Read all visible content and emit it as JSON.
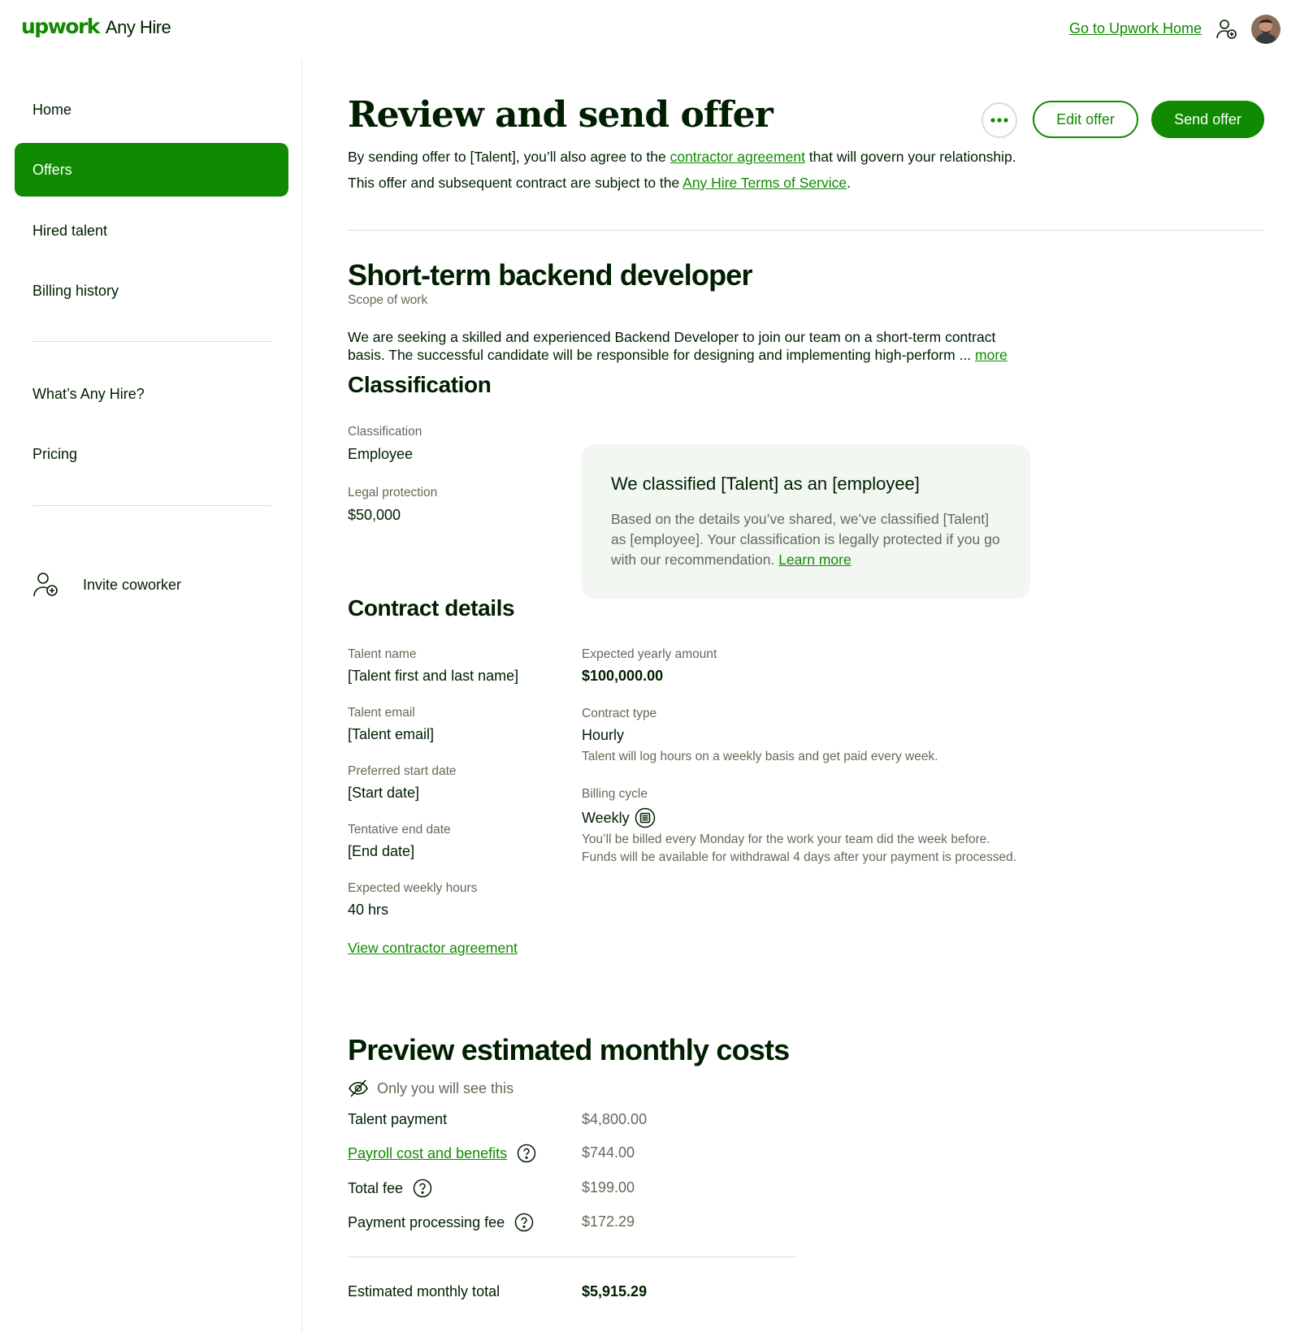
{
  "header": {
    "brand": "upwork",
    "product": "Any Hire",
    "home_link": "Go to Upwork Home"
  },
  "sidebar": {
    "items": [
      {
        "label": "Home"
      },
      {
        "label": "Offers",
        "active": true
      },
      {
        "label": "Hired talent"
      },
      {
        "label": "Billing history"
      }
    ],
    "info_items": [
      {
        "label": "What’s Any Hire?"
      },
      {
        "label": "Pricing"
      }
    ],
    "invite": "Invite coworker"
  },
  "page": {
    "title": "Review and send offer",
    "edit_button": "Edit offer",
    "send_button": "Send offer",
    "intro1_pre": "By sending offer to [Talent], you’ll also agree to the ",
    "intro1_link": "contractor agreement",
    "intro1_post": " that will govern your relationship.",
    "intro2_pre": "This offer and subsequent contract are subject to the ",
    "intro2_link": "Any Hire Terms of Service",
    "intro2_post": "."
  },
  "job": {
    "title": "Short-term backend developer",
    "scope_label": "Scope of work",
    "scope_text": "We are seeking a skilled and experienced Backend Developer to join our team on a short-term contract basis. The successful candidate will be responsible for designing and implementing high-perform ... ",
    "scope_more": "more"
  },
  "classification": {
    "heading": "Classification",
    "class_label": "Classification",
    "class_value": "Employee",
    "legal_label": "Legal protection",
    "legal_value": "$50,000",
    "card_title": "We classified [Talent] as an [employee]",
    "card_body": "Based on the details you’ve shared, we’ve classified [Talent] as [employee]. Your classification is legally protected if you go with our recommendation. ",
    "card_link": "Learn more"
  },
  "contract": {
    "heading": "Contract details",
    "talent_name_label": "Talent name",
    "talent_name": "[Talent first and last name]",
    "talent_email_label": "Talent email",
    "talent_email": "[Talent email]",
    "start_label": "Preferred start date",
    "start": "[Start date]",
    "end_label": "Tentative end date",
    "end": "[End date]",
    "hours_label": "Expected weekly hours",
    "hours": "40 hrs",
    "yearly_label": "Expected yearly amount",
    "yearly": "$100,000.00",
    "type_label": "Contract type",
    "type": "Hourly",
    "type_note": "Talent will log hours on a weekly basis and get paid every week.",
    "billing_label": "Billing cycle",
    "billing": "Weekly",
    "billing_note1": "You’ll be billed every Monday for the work your team did the week before.",
    "billing_note2": "Funds will be available for withdrawal 4 days after your payment is processed.",
    "agreement_link": "View contractor agreement"
  },
  "costs": {
    "heading": "Preview estimated monthly costs",
    "private_note": "Only you will see this",
    "rows": [
      {
        "label": "Talent payment",
        "value": "$4,800.00"
      },
      {
        "label": "Payroll cost and benefits",
        "value": "$744.00"
      },
      {
        "label": "Total fee",
        "value": "$199.00"
      },
      {
        "label": "Payment processing fee",
        "value": "$172.29"
      }
    ],
    "total_label": "Estimated monthly total",
    "total_value": "$5,915.29"
  },
  "colors": {
    "brand_green": "#108a00",
    "text_dark": "#001e00",
    "text_muted": "#5e6d55",
    "card_bg": "#f2f7f2"
  }
}
